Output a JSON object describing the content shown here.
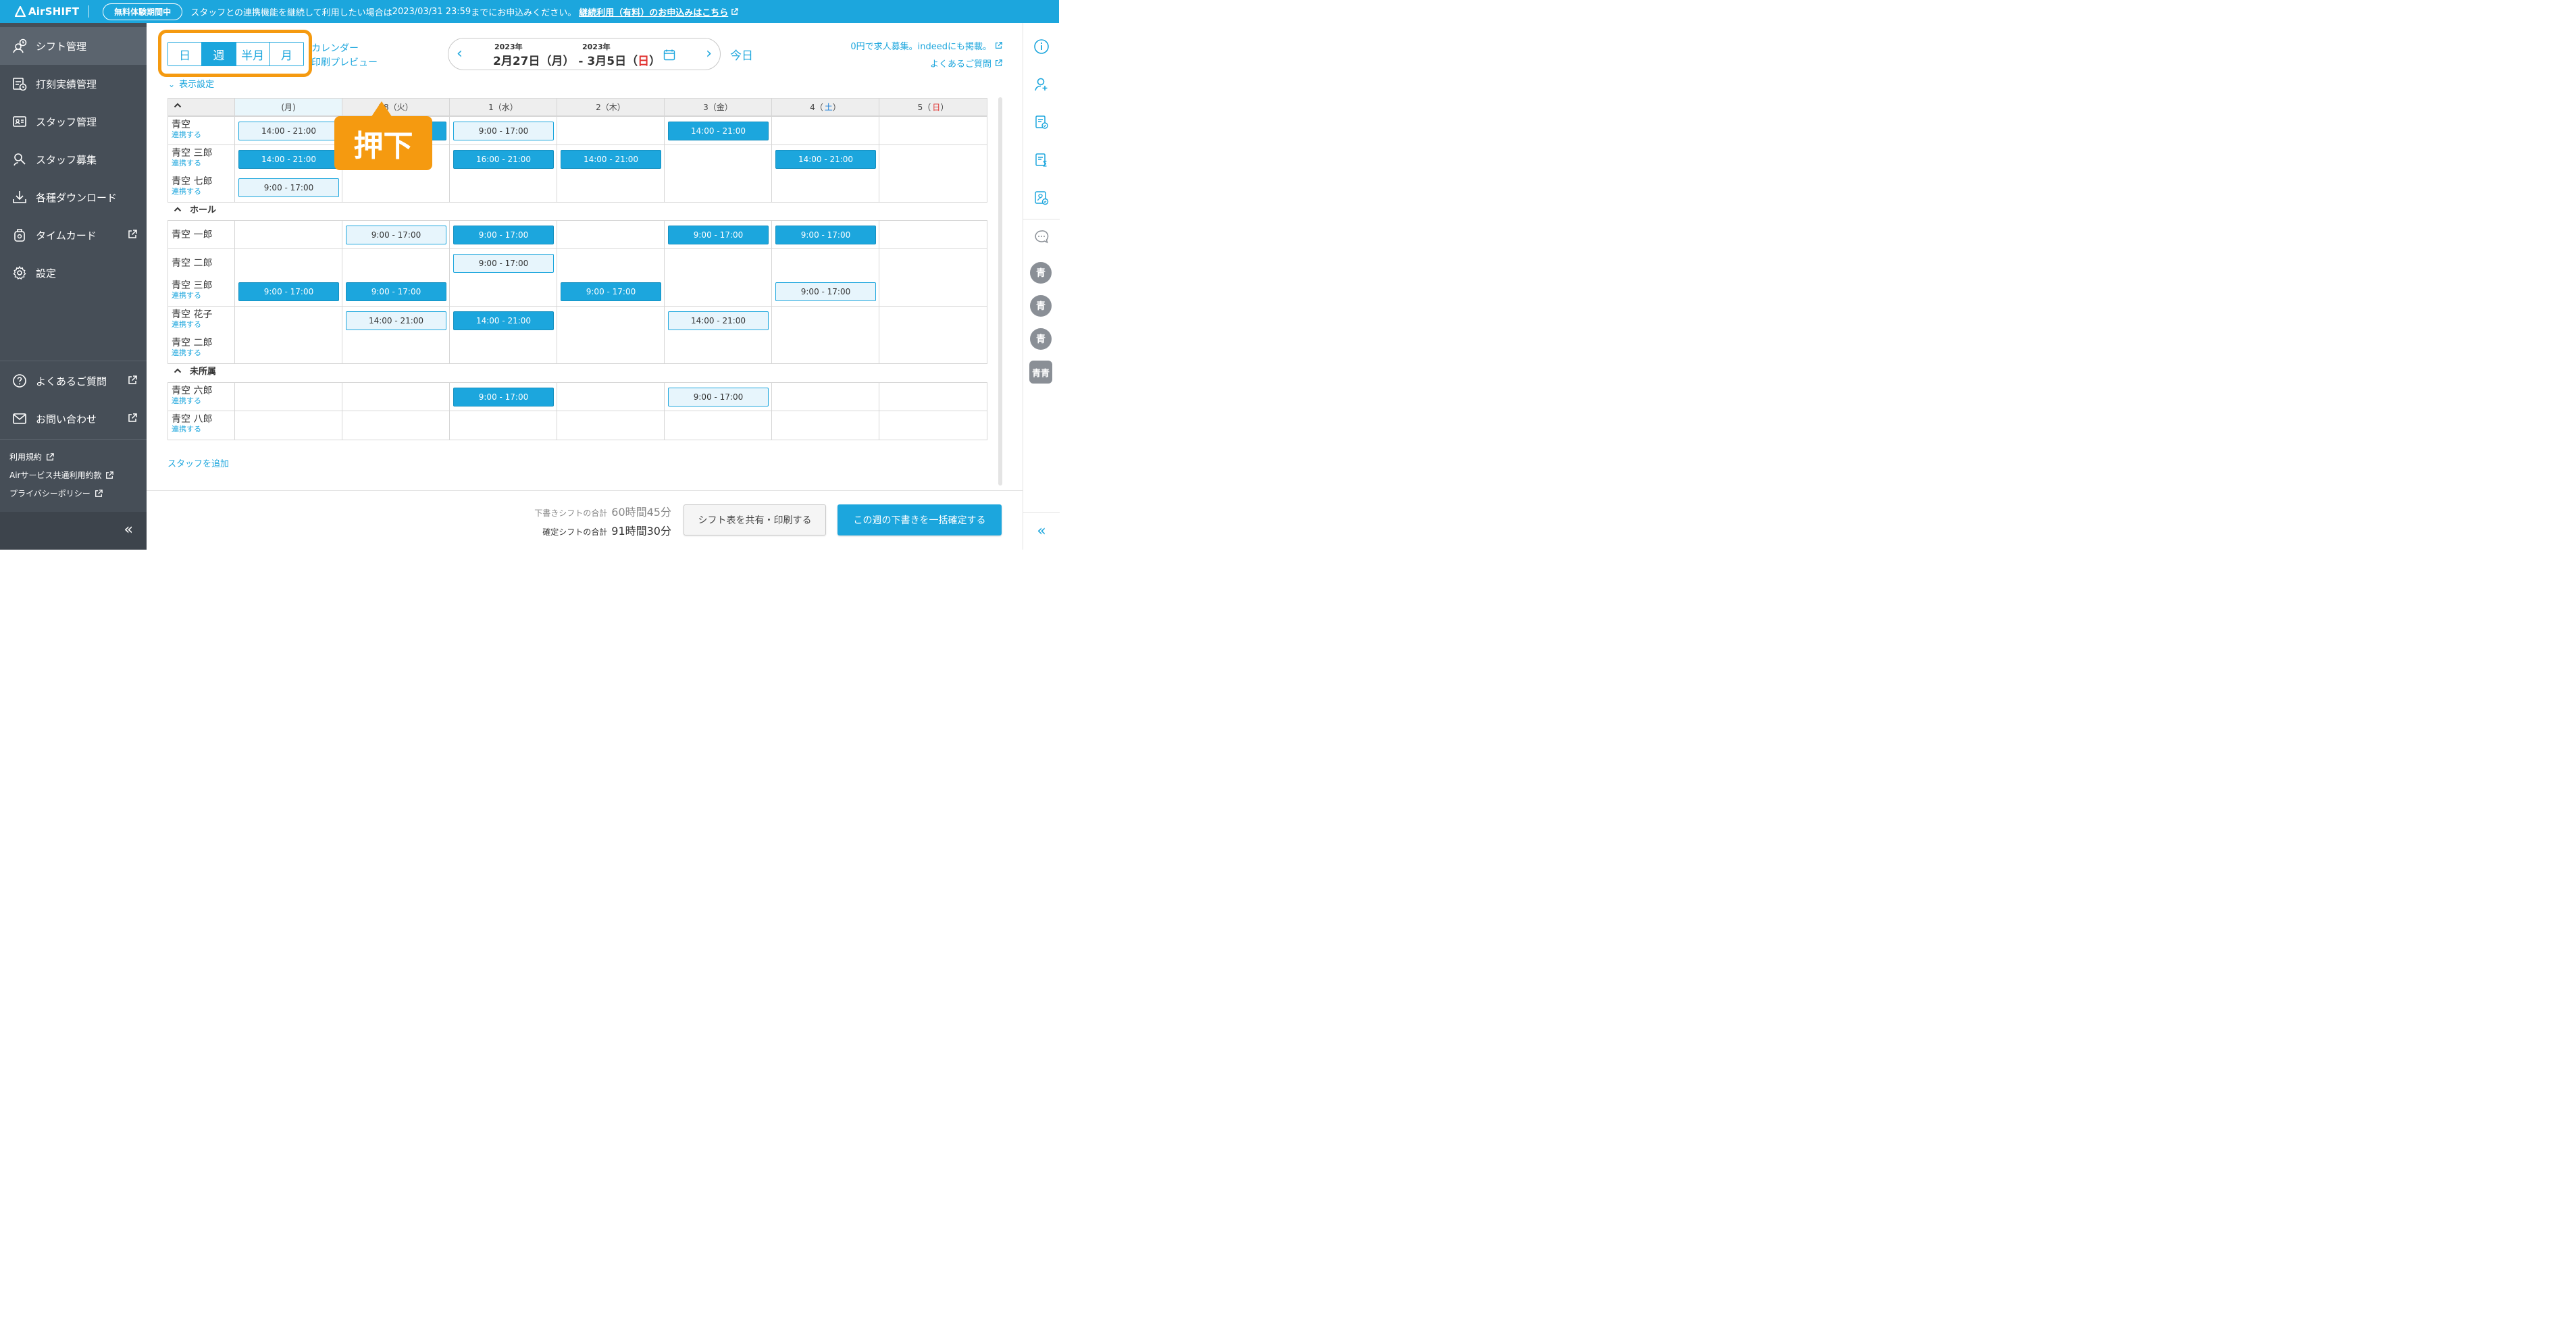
{
  "topbar": {
    "logo": "AirSHIFT",
    "trial_badge": "無料体験期間中",
    "notice_pre": "スタッフとの連携機能を継続して利用したい場合は",
    "notice_date": "2023/03/31 23:59",
    "notice_post": "までにお申込みください。",
    "notice_link": "継続利用（有料）のお申込みはこちら"
  },
  "sidebar": {
    "items": [
      {
        "label": "シフト管理",
        "icon": "shift-icon"
      },
      {
        "label": "打刻実績管理",
        "icon": "time-record-icon"
      },
      {
        "label": "スタッフ管理",
        "icon": "staff-icon"
      },
      {
        "label": "スタッフ募集",
        "icon": "recruit-icon"
      },
      {
        "label": "各種ダウンロード",
        "icon": "download-icon"
      },
      {
        "label": "タイムカード",
        "icon": "timecard-icon"
      },
      {
        "label": "設定",
        "icon": "gear-icon"
      }
    ],
    "faq": "よくあるご質問",
    "contact": "お問い合わせ",
    "terms": "利用規約",
    "common_terms": "Airサービス共通利用約款",
    "privacy": "プライバシーポリシー",
    "collapse": "«"
  },
  "toolbar": {
    "views": [
      "日",
      "週",
      "半月",
      "月"
    ],
    "active_view": "週",
    "calendar_link": "カレンダー",
    "print_link": "印刷プレビュー",
    "year_start": "2023年",
    "year_end": "2023年",
    "range_start": "2月27日（月）",
    "range_sep": " - ",
    "range_end_pre": "3月5日（",
    "range_end_day": "日",
    "range_end_post": "）",
    "today": "今日",
    "indeed_link": "0円で求人募集。indeedにも掲載。",
    "faq_link": "よくあるご質問",
    "display_settings": "表示設定"
  },
  "callout": "押下",
  "grid": {
    "header_days": [
      "(月)",
      "28（火）",
      "1（水）",
      "2（木）",
      "3（金）",
      "4（",
      "5（"
    ],
    "sat_char": "土",
    "sun_char": "日",
    "close_paren": "）",
    "link_label": "連携する",
    "groups": [
      {
        "name": "",
        "rows": [
          {
            "name": "青空",
            "linked": true,
            "shifts": [
              [
                "draft",
                "14:00 - 21:00"
              ],
              [
                "confirmed",
                "14:00 - 21:00"
              ],
              [
                "draft",
                "9:00 - 17:00"
              ],
              null,
              [
                "confirmed",
                "14:00 - 21:00"
              ],
              null,
              null
            ]
          },
          {
            "name": "青空 三郎",
            "linked": true,
            "shifts": [
              [
                "confirmed",
                "14:00 - 21:00"
              ],
              null,
              [
                "confirmed",
                "16:00 - 21:00"
              ],
              [
                "confirmed",
                "14:00 - 21:00"
              ],
              null,
              [
                "confirmed",
                "14:00 - 21:00"
              ],
              null
            ]
          },
          {
            "name": "青空 七郎",
            "linked": true,
            "shifts": [
              [
                "draft",
                "9:00 - 17:00"
              ],
              null,
              null,
              null,
              null,
              null,
              null
            ]
          }
        ]
      },
      {
        "name": "ホール",
        "rows": [
          {
            "name": "青空 一郎",
            "linked": false,
            "shifts": [
              null,
              [
                "draft",
                "9:00 - 17:00"
              ],
              [
                "confirmed",
                "9:00 - 17:00"
              ],
              null,
              [
                "confirmed",
                "9:00 - 17:00"
              ],
              [
                "confirmed",
                "9:00 - 17:00"
              ],
              null
            ]
          },
          {
            "name": "青空 二郎",
            "linked": false,
            "shifts": [
              null,
              null,
              [
                "draft",
                "9:00 - 17:00"
              ],
              null,
              null,
              null,
              null
            ]
          },
          {
            "name": "青空 三郎",
            "linked": true,
            "shifts": [
              [
                "confirmed",
                "9:00 - 17:00"
              ],
              [
                "confirmed",
                "9:00 - 17:00"
              ],
              null,
              [
                "confirmed",
                "9:00 - 17:00"
              ],
              null,
              [
                "draft",
                "9:00 - 17:00"
              ],
              null
            ]
          },
          {
            "name": "青空 花子",
            "linked": true,
            "shifts": [
              null,
              [
                "draft",
                "14:00 - 21:00"
              ],
              [
                "confirmed",
                "14:00 - 21:00"
              ],
              null,
              [
                "draft",
                "14:00 - 21:00"
              ],
              null,
              null
            ]
          },
          {
            "name": "青空 二郎",
            "linked": true,
            "shifts": [
              null,
              null,
              null,
              null,
              null,
              null,
              null
            ]
          }
        ]
      },
      {
        "name": "未所属",
        "rows": [
          {
            "name": "青空 六郎",
            "linked": true,
            "shifts": [
              null,
              null,
              [
                "confirmed",
                "9:00 - 17:00"
              ],
              null,
              [
                "draft",
                "9:00 - 17:00"
              ],
              null,
              null
            ]
          },
          {
            "name": "青空 八郎",
            "linked": true,
            "shifts": [
              null,
              null,
              null,
              null,
              null,
              null,
              null
            ]
          }
        ]
      }
    ],
    "add_staff": "スタッフを追加"
  },
  "rightrail": {
    "avatars": [
      "青",
      "青",
      "青",
      "青青"
    ],
    "collapse": "«"
  },
  "bottombar": {
    "draft_label": "下書きシフトの合計",
    "draft_value": "60時間45分",
    "confirm_label": "確定シフトの合計",
    "confirm_value": "91時間30分",
    "share_button": "シフト表を共有・印刷する",
    "confirm_button": "この週の下書きを一括確定する"
  },
  "colors": {
    "brand": "#1ca6dd",
    "sidebar": "#464e57",
    "accent_orange": "#f59a10",
    "sunday": "#e0312f",
    "saturday": "#1c7fd6"
  }
}
